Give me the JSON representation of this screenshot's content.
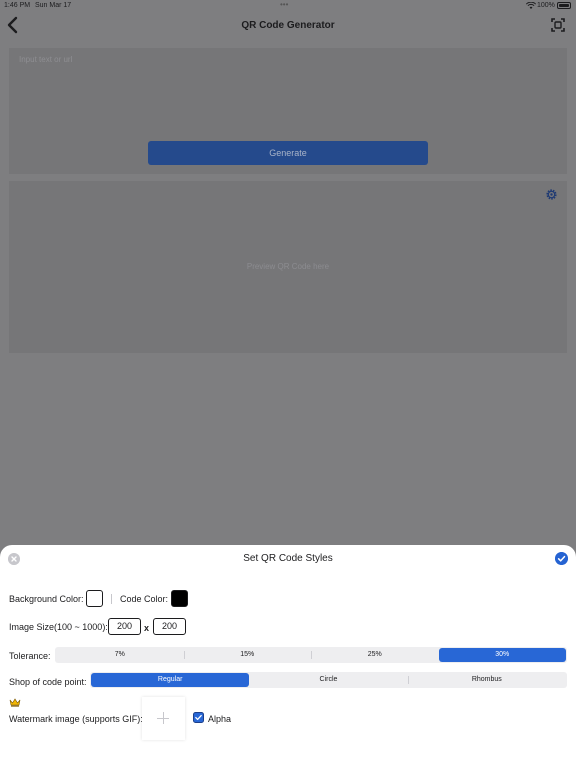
{
  "status_bar": {
    "time": "1:46 PM",
    "date": "Sun Mar 17",
    "dots": "•••",
    "battery_pct": "100%"
  },
  "nav": {
    "title": "QR Code Generator",
    "back_icon": "chevron-left-icon",
    "scan_icon": "scan-icon"
  },
  "input": {
    "placeholder": "Input text or url"
  },
  "generate_label": "Generate",
  "preview": {
    "placeholder": "Preview QR Code here",
    "settings_icon": "gear-icon"
  },
  "sheet": {
    "title": "Set QR Code Styles",
    "close_icon": "close-icon",
    "confirm_icon": "checkmark-icon",
    "background_color_label": "Background Color:",
    "background_color": "#ffffff",
    "code_color_label": "Code Color:",
    "code_color": "#000000",
    "image_size_label": "Image Size(100 ~ 1000):",
    "width": "200",
    "times": "x",
    "height": "200",
    "tolerance_label": "Tolerance:",
    "tolerance_options": [
      "7%",
      "15%",
      "25%",
      "30%"
    ],
    "tolerance_selected": "30%",
    "shape_label": "Shop of code point:",
    "shape_options": [
      "Regular",
      "Circle",
      "Rhombus"
    ],
    "shape_selected": "Regular",
    "watermark_label": "Watermark image (supports GIF):",
    "crown_icon": "crown-icon",
    "add_icon": "plus-icon",
    "alpha_label": "Alpha",
    "alpha_checked": true
  },
  "colors": {
    "accent": "#2867d6",
    "dim_overlay": "#7e7e80"
  }
}
